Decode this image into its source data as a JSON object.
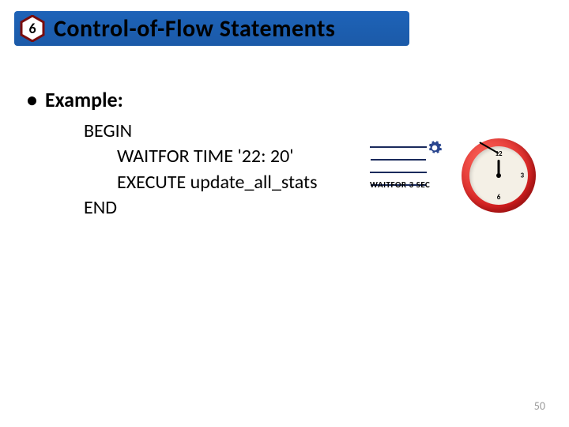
{
  "header": {
    "section_number": "6",
    "title": "Control-of-Flow Statements"
  },
  "body": {
    "bullet_label": "Example:",
    "code": {
      "l1": "BEGIN",
      "l2": "WAITFOR TIME '22: 20'",
      "l3": "EXECUTE update_all_stats",
      "l4": "END"
    }
  },
  "illustration": {
    "waitfor_label": "WAITFOR 3 SEC",
    "clock_numbers": {
      "twelve": "12",
      "three": "3",
      "six": "6"
    }
  },
  "page_number": "50"
}
